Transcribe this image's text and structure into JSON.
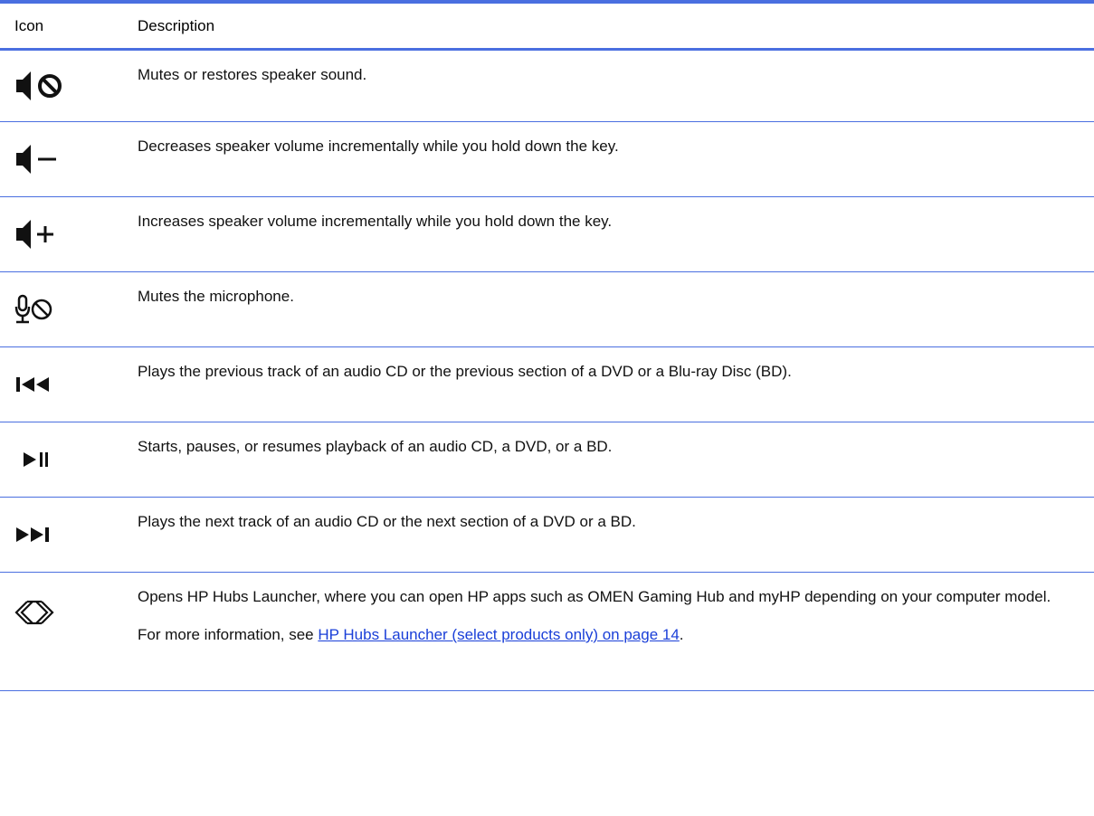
{
  "table": {
    "headers": {
      "icon": "Icon",
      "description": "Description"
    },
    "rows": [
      {
        "icon": "speaker-mute-icon",
        "description": "Mutes or restores speaker sound."
      },
      {
        "icon": "volume-down-icon",
        "description": "Decreases speaker volume incrementally while you hold down the key."
      },
      {
        "icon": "volume-up-icon",
        "description": "Increases speaker volume incrementally while you hold down the key."
      },
      {
        "icon": "microphone-mute-icon",
        "description": "Mutes the microphone."
      },
      {
        "icon": "previous-track-icon",
        "description": "Plays the previous track of an audio CD or the previous section of a DVD or a Blu-ray Disc (BD)."
      },
      {
        "icon": "play-pause-icon",
        "description": "Starts, pauses, or resumes playback of an audio CD, a DVD, or a BD."
      },
      {
        "icon": "next-track-icon",
        "description": "Plays the next track of an audio CD or the next section of a DVD or a BD."
      },
      {
        "icon": "hp-hubs-launcher-icon",
        "description": "Opens HP Hubs Launcher, where you can open HP apps such as OMEN Gaming Hub and myHP depending on your computer model.",
        "note_prefix": "For more information, see ",
        "note_link": "HP Hubs Launcher (select products only) on page 14",
        "note_suffix": "."
      }
    ]
  },
  "colors": {
    "rule": "#4a6fe0",
    "link": "#1a3fd8",
    "text": "#111111"
  }
}
